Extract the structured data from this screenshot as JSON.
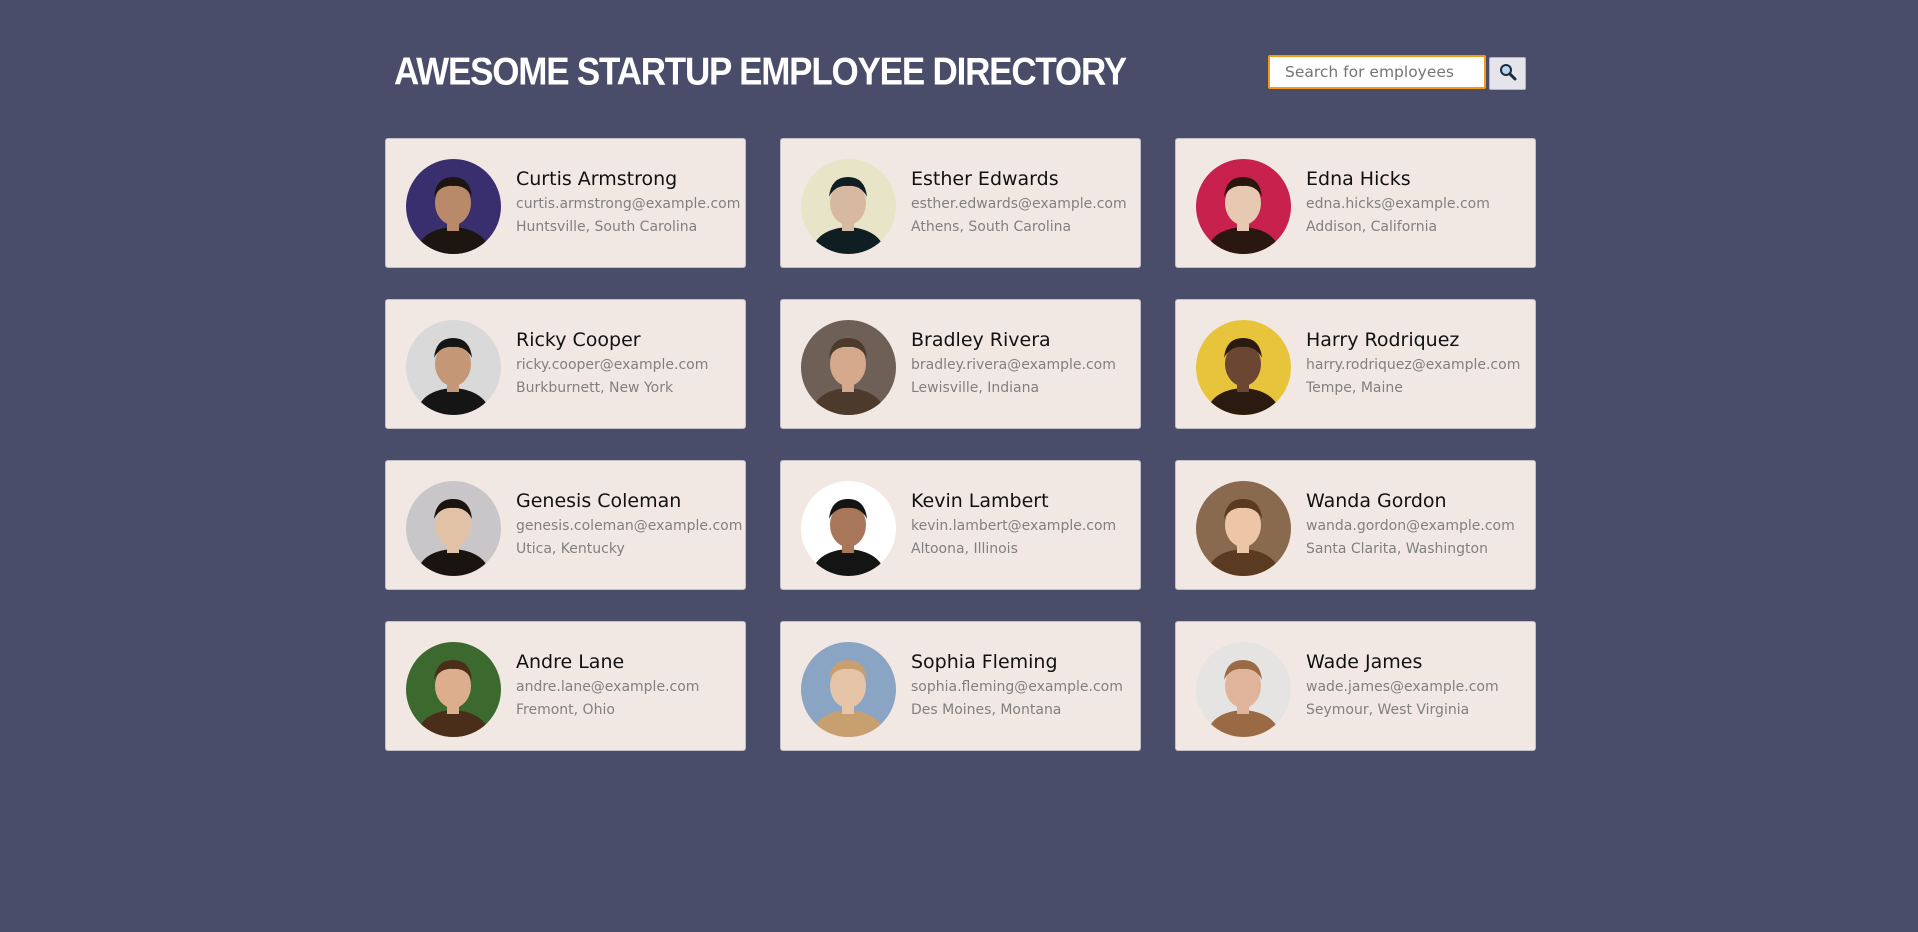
{
  "header": {
    "title": "Awesome Startup Employee Directory"
  },
  "search": {
    "placeholder": "Search for employees",
    "value": "",
    "button_icon": "magnifier-icon"
  },
  "employees": [
    {
      "name": "Curtis Armstrong",
      "email": "curtis.armstrong@example.com",
      "location": "Huntsville, South Carolina",
      "photo_bg": "#3a2f6e",
      "skin": "#b98a6a",
      "hair": "#1c1510"
    },
    {
      "name": "Esther Edwards",
      "email": "esther.edwards@example.com",
      "location": "Athens, South Carolina",
      "photo_bg": "#e8e4c8",
      "skin": "#d7b9a2",
      "hair": "#0f1e22"
    },
    {
      "name": "Edna Hicks",
      "email": "edna.hicks@example.com",
      "location": "Addison, California",
      "photo_bg": "#c8214e",
      "skin": "#e7c8b0",
      "hair": "#2a1810"
    },
    {
      "name": "Ricky Cooper",
      "email": "ricky.cooper@example.com",
      "location": "Burkburnett, New York",
      "photo_bg": "#d9d9d9",
      "skin": "#c49877",
      "hair": "#151515"
    },
    {
      "name": "Bradley Rivera",
      "email": "bradley.rivera@example.com",
      "location": "Lewisville, Indiana",
      "photo_bg": "#6e6056",
      "skin": "#d4a98c",
      "hair": "#4c3a2c"
    },
    {
      "name": "Harry Rodriquez",
      "email": "harry.rodriquez@example.com",
      "location": "Tempe, Maine",
      "photo_bg": "#e8c43c",
      "skin": "#6b4632",
      "hair": "#2a1a10"
    },
    {
      "name": "Genesis Coleman",
      "email": "genesis.coleman@example.com",
      "location": "Utica, Kentucky",
      "photo_bg": "#c8c6c8",
      "skin": "#e2c2a6",
      "hair": "#1a1410"
    },
    {
      "name": "Kevin Lambert",
      "email": "kevin.lambert@example.com",
      "location": "Altoona, Illinois",
      "photo_bg": "#ffffff",
      "skin": "#a87658",
      "hair": "#141414"
    },
    {
      "name": "Wanda Gordon",
      "email": "wanda.gordon@example.com",
      "location": "Santa Clarita, Washington",
      "photo_bg": "#8a6a4e",
      "skin": "#ecc6a6",
      "hair": "#5a3a20"
    },
    {
      "name": "Andre Lane",
      "email": "andre.lane@example.com",
      "location": "Fremont, Ohio",
      "photo_bg": "#3c6a2e",
      "skin": "#dcae8e",
      "hair": "#4a2e1a"
    },
    {
      "name": "Sophia Fleming",
      "email": "sophia.fleming@example.com",
      "location": "Des Moines, Montana",
      "photo_bg": "#8aa4c4",
      "skin": "#e6c4a8",
      "hair": "#c8a070"
    },
    {
      "name": "Wade James",
      "email": "wade.james@example.com",
      "location": "Seymour, West Virginia",
      "photo_bg": "#e6e4e2",
      "skin": "#e0b49a",
      "hair": "#9a6a44"
    }
  ]
}
